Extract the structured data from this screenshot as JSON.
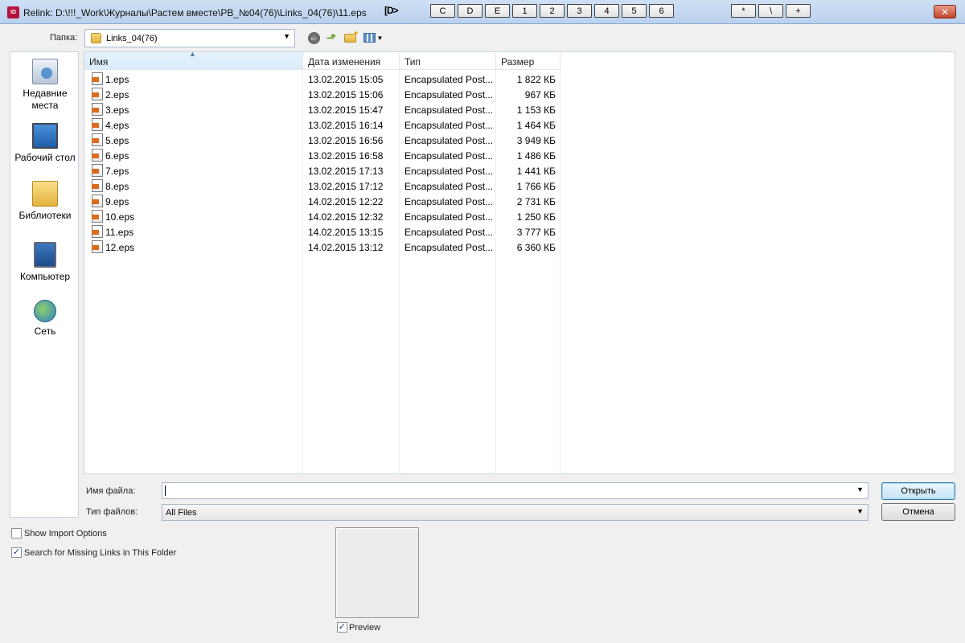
{
  "window": {
    "app_icon": "ID",
    "title": "Relink: D:\\!!!_Work\\Журналы\\Растем вместе\\PB_№04(76)\\Links_04(76)\\11.eps",
    "id_mark": "[D>",
    "drive_buttons": [
      "C",
      "D",
      "E",
      "1",
      "2",
      "3",
      "4",
      "5",
      "6"
    ],
    "extra_buttons": [
      "*",
      "\\",
      "+"
    ],
    "close_label": "X"
  },
  "toolbar": {
    "folder_label": "Папка:",
    "folder_value": "Links_04(76)",
    "icons": [
      "back-icon",
      "up-folder-icon",
      "new-folder-icon",
      "view-menu-icon"
    ]
  },
  "places": [
    {
      "label": "Недавние места",
      "icon": "recent-places-icon"
    },
    {
      "label": "Рабочий стол",
      "icon": "desktop-icon"
    },
    {
      "label": "Библиотеки",
      "icon": "libraries-icon"
    },
    {
      "label": "Компьютер",
      "icon": "computer-icon"
    },
    {
      "label": "Сеть",
      "icon": "network-icon"
    }
  ],
  "columns": {
    "name": "Имя",
    "date": "Дата изменения",
    "type": "Тип",
    "size": "Размер"
  },
  "files": [
    {
      "name": "1.eps",
      "date": "13.02.2015 15:05",
      "type": "Encapsulated Post...",
      "size": "1 822 КБ"
    },
    {
      "name": "2.eps",
      "date": "13.02.2015 15:06",
      "type": "Encapsulated Post...",
      "size": "967 КБ"
    },
    {
      "name": "3.eps",
      "date": "13.02.2015 15:47",
      "type": "Encapsulated Post...",
      "size": "1 153 КБ"
    },
    {
      "name": "4.eps",
      "date": "13.02.2015 16:14",
      "type": "Encapsulated Post...",
      "size": "1 464 КБ"
    },
    {
      "name": "5.eps",
      "date": "13.02.2015 16:56",
      "type": "Encapsulated Post...",
      "size": "3 949 КБ"
    },
    {
      "name": "6.eps",
      "date": "13.02.2015 16:58",
      "type": "Encapsulated Post...",
      "size": "1 486 КБ"
    },
    {
      "name": "7.eps",
      "date": "13.02.2015 17:13",
      "type": "Encapsulated Post...",
      "size": "1 441 КБ"
    },
    {
      "name": "8.eps",
      "date": "13.02.2015 17:12",
      "type": "Encapsulated Post...",
      "size": "1 766 КБ"
    },
    {
      "name": "9.eps",
      "date": "14.02.2015 12:22",
      "type": "Encapsulated Post...",
      "size": "2 731 КБ"
    },
    {
      "name": "10.eps",
      "date": "14.02.2015 12:32",
      "type": "Encapsulated Post...",
      "size": "1 250 КБ"
    },
    {
      "name": "11.eps",
      "date": "14.02.2015 13:15",
      "type": "Encapsulated Post...",
      "size": "3 777 КБ"
    },
    {
      "name": "12.eps",
      "date": "14.02.2015 13:12",
      "type": "Encapsulated Post...",
      "size": "6 360 КБ"
    }
  ],
  "form": {
    "filename_label": "Имя файла:",
    "filename_value": "",
    "filetype_label": "Тип файлов:",
    "filetype_value": "All Files",
    "open_button": "Открыть",
    "cancel_button": "Отмена"
  },
  "options": {
    "show_import_options": {
      "label": "Show Import Options",
      "checked": false
    },
    "search_missing_links": {
      "label": "Search for Missing Links in This Folder",
      "checked": true
    },
    "preview": {
      "label": "Preview",
      "checked": true
    }
  },
  "colors": {
    "titlebar": "#c4d9f1",
    "sorted_header": "#dcecfb",
    "default_button": "#c4e3f7",
    "close_button": "#c6432c",
    "eps_icon_accent": "#d96b1f"
  }
}
